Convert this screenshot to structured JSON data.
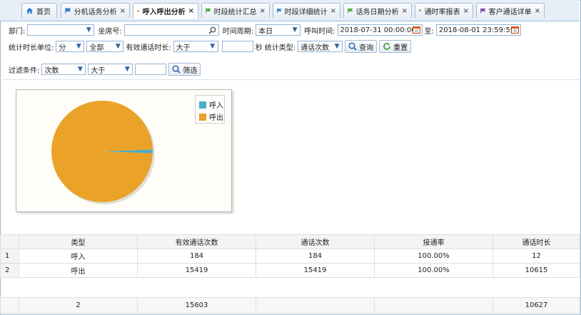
{
  "tabs": [
    {
      "label": "首页",
      "icon": "home-icon",
      "closable": false
    },
    {
      "label": "分机话务分析",
      "icon": "flag-icon",
      "closable": true
    },
    {
      "label": "呼入呼出分析",
      "icon": "flag-icon",
      "closable": true,
      "active": true
    },
    {
      "label": "时段统计汇总",
      "icon": "flag-icon",
      "closable": true
    },
    {
      "label": "时段详细统计",
      "icon": "flag-icon",
      "closable": true
    },
    {
      "label": "话务日期分析",
      "icon": "flag-icon",
      "closable": true
    },
    {
      "label": "通时率报表",
      "icon": "flag-icon",
      "closable": true
    },
    {
      "label": "客户通话详单",
      "icon": "flag-icon",
      "closable": true
    }
  ],
  "close_glyph": "×",
  "filters": {
    "dept_label": "部门:",
    "dept_value": "",
    "seat_label": "坐席号:",
    "seat_value": "",
    "period_label": "时间周期:",
    "period_value": "本日",
    "calltime_label": "呼叫时间:",
    "start_time": "2018-07-31 00:00:00",
    "to_label": "至:",
    "end_time": "2018-08-01 23:59:59",
    "unit_label": "统计时长单位:",
    "unit_value": "分",
    "scope_value": "全部",
    "valid_label": "有效通话时长:",
    "valid_op": "大于",
    "valid_value": "",
    "sec_label": "秒",
    "stat_type_label": "统计类型:",
    "stat_type_value": "通话次数",
    "query_label": "查询",
    "reset_label": "重置",
    "cond_label": "过滤条件:",
    "cond_field": "次数",
    "cond_op": "大于",
    "cond_value": "",
    "filter_label": "筛选"
  },
  "chart_data": {
    "type": "pie",
    "slices": [
      {
        "name": "呼入",
        "value": 184,
        "color": "#4bacc6"
      },
      {
        "name": "呼出",
        "value": 15419,
        "color": "#eaa228"
      }
    ],
    "legend_position": "top-right"
  },
  "table": {
    "headers": [
      "类型",
      "有效通话次数",
      "通话次数",
      "接通率",
      "通话时长"
    ],
    "rows": [
      {
        "n": "1",
        "cells": [
          "呼入",
          "184",
          "184",
          "100.00%",
          "12"
        ]
      },
      {
        "n": "2",
        "cells": [
          "呼出",
          "15419",
          "15419",
          "100.00%",
          "10615"
        ]
      }
    ],
    "footer": [
      "2",
      "15603",
      "",
      "",
      "10627"
    ]
  },
  "colors": {
    "accent": "#2e64a6",
    "tab_border": "#a6bdd6",
    "flag_blue": "#2f7bd6",
    "flag_green": "#4caf3f",
    "flag_purple": "#7b4fb3"
  }
}
